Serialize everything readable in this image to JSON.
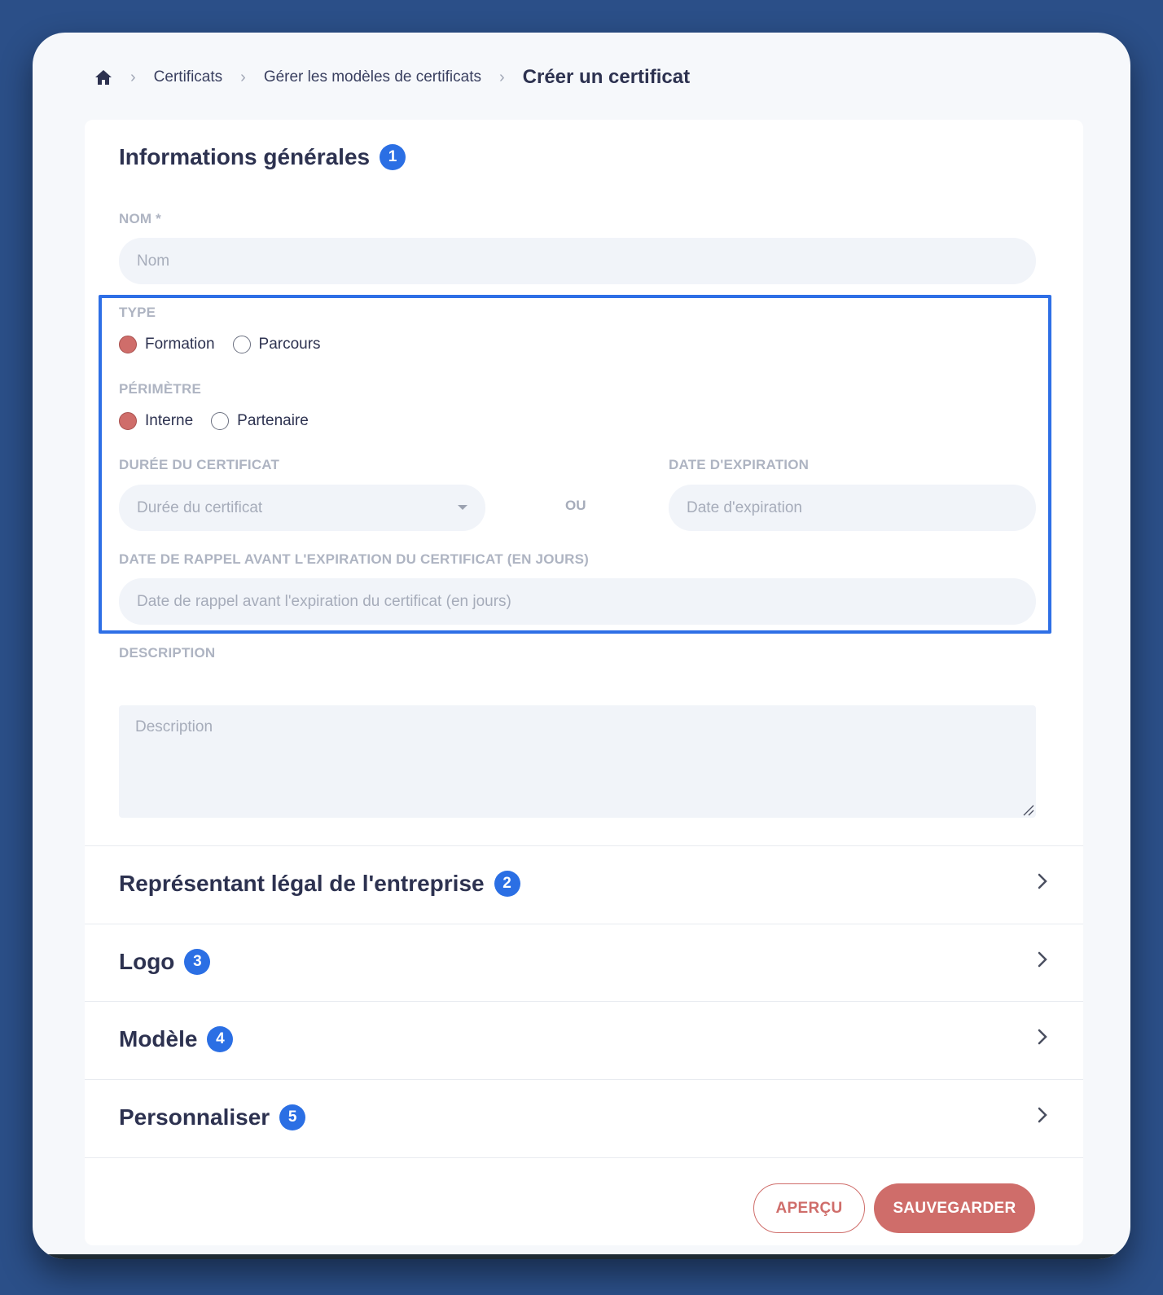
{
  "breadcrumb": {
    "items": [
      "Certificats",
      "Gérer les modèles de certificats"
    ],
    "current": "Créer un certificat"
  },
  "general": {
    "title": "Informations générales",
    "step": "1",
    "name": {
      "label": "NOM *",
      "placeholder": "Nom"
    },
    "type": {
      "label": "TYPE",
      "options": [
        "Formation",
        "Parcours"
      ],
      "selected": "Formation"
    },
    "scope": {
      "label": "PÉRIMÈTRE",
      "options": [
        "Interne",
        "Partenaire"
      ],
      "selected": "Interne"
    },
    "duration": {
      "label": "DURÉE DU CERTIFICAT",
      "placeholder": "Durée du certificat"
    },
    "or_text": "OU",
    "expiration": {
      "label": "DATE D'EXPIRATION",
      "placeholder": "Date d'expiration"
    },
    "reminder": {
      "label": "DATE DE RAPPEL AVANT L'EXPIRATION DU CERTIFICAT (EN JOURS)",
      "placeholder": "Date de rappel avant l'expiration du certificat (en jours)"
    },
    "description": {
      "label": "DESCRIPTION",
      "placeholder": "Description"
    }
  },
  "sections": [
    {
      "title": "Représentant légal de l'entreprise",
      "step": "2"
    },
    {
      "title": "Logo",
      "step": "3"
    },
    {
      "title": "Modèle",
      "step": "4"
    },
    {
      "title": "Personnaliser",
      "step": "5"
    }
  ],
  "actions": {
    "preview": "APERÇU",
    "save": "SAUVEGARDER"
  },
  "colors": {
    "accent": "#cf6d6a",
    "badge": "#2b6fe4",
    "highlight": "#2e6fe6",
    "background": "#2b4f88"
  },
  "icons": {
    "home": "home-icon",
    "chevron": "chevron-right-icon",
    "caret": "caret-down-icon"
  }
}
